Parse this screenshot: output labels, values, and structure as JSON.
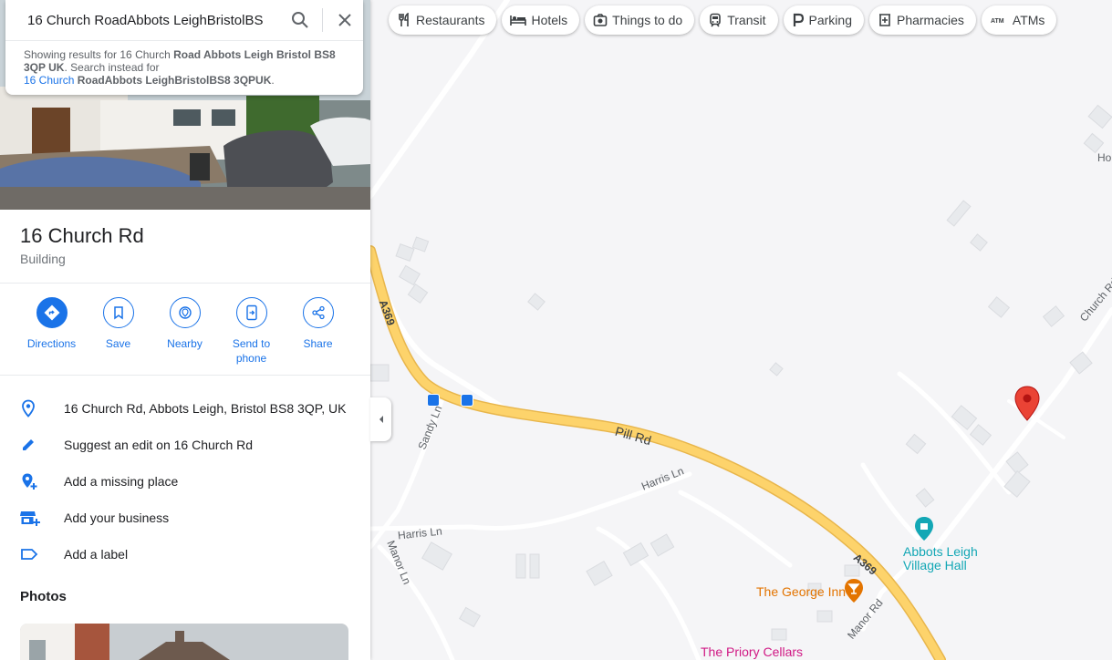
{
  "search": {
    "query": "16 Church RoadAbbots LeighBristolBS",
    "suggest_prefix": "Showing results for 16 Church ",
    "suggest_bold": "Road Abbots Leigh Bristol BS8 3QP UK",
    "suggest_mid": ". Search instead for",
    "suggest_link_a": "16 Church ",
    "suggest_link_b": "RoadAbbots LeighBristolBS8 3QPUK",
    "suggest_end": "."
  },
  "place": {
    "name": "16 Church Rd",
    "category": "Building"
  },
  "actions": [
    {
      "label": "Directions",
      "icon": "directions-icon"
    },
    {
      "label": "Save",
      "icon": "bookmark-icon"
    },
    {
      "label": "Nearby",
      "icon": "nearby-icon"
    },
    {
      "label": "Send to phone",
      "icon": "send-to-phone-icon"
    },
    {
      "label": "Share",
      "icon": "share-icon"
    }
  ],
  "info_rows": [
    {
      "text": "16 Church Rd, Abbots Leigh, Bristol BS8 3QP, UK",
      "icon": "location-pin-icon"
    },
    {
      "text": "Suggest an edit on 16 Church Rd",
      "icon": "pencil-icon"
    },
    {
      "text": "Add a missing place",
      "icon": "add-place-icon"
    },
    {
      "text": "Add your business",
      "icon": "add-business-icon"
    },
    {
      "text": "Add a label",
      "icon": "label-icon"
    }
  ],
  "photos_heading": "Photos",
  "chips": [
    {
      "label": "Restaurants",
      "icon": "restaurant-icon"
    },
    {
      "label": "Hotels",
      "icon": "hotel-icon"
    },
    {
      "label": "Things to do",
      "icon": "camera-icon"
    },
    {
      "label": "Transit",
      "icon": "transit-icon"
    },
    {
      "label": "Parking",
      "icon": "parking-icon"
    },
    {
      "label": "Pharmacies",
      "icon": "pharmacy-icon"
    },
    {
      "label": "ATMs",
      "icon": "atm-icon"
    }
  ],
  "map": {
    "roads": {
      "a369_north": "A369",
      "a369_south": "A369",
      "pill_rd": "Pill Rd",
      "sandy_ln": "Sandy Ln",
      "harris_ln_east": "Harris Ln",
      "harris_ln_west": "Harris Ln",
      "manor_ln": "Manor Ln",
      "manor_rd": "Manor Rd",
      "church_rd": "Church Rd",
      "ho_fragment": "Ho"
    },
    "pois": {
      "village_hall": "Abbots Leigh Village Hall",
      "george_inn": "The George Inn",
      "priory_cellars": "The Priory Cellars"
    },
    "colors": {
      "major_road": "#fdd36b",
      "marker": "#ea4335",
      "poi_civic": "#13a7b5",
      "poi_food": "#e37400",
      "poi_shop": "#d01884",
      "accent": "#1a73e8"
    }
  }
}
